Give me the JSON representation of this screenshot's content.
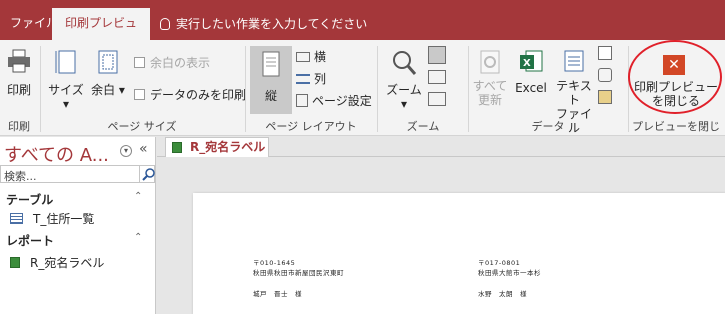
{
  "tabs": {
    "file": "ファイル",
    "print_preview": "印刷プレビュー",
    "tell_me": "実行したい作業を入力してください"
  },
  "ribbon": {
    "print": {
      "print_btn": "印刷",
      "group": "印刷"
    },
    "page_size": {
      "size": "サイズ",
      "margin": "余白",
      "show_margin": "余白の表示",
      "data_only": "データのみを印刷",
      "group": "ページ サイズ"
    },
    "page_layout": {
      "portrait": "縦",
      "landscape": "横",
      "columns": "列",
      "page_setup": "ページ設定",
      "group": "ページ レイアウト"
    },
    "zoom": {
      "zoom": "ズーム",
      "group": "ズーム"
    },
    "data": {
      "refresh_all": "すべて更新",
      "refresh_line1": "すべて",
      "refresh_line2": "更新",
      "excel": "Excel",
      "text_line1": "テキスト",
      "text_line2": "ファイル",
      "group": "データ"
    },
    "close": {
      "line1": "印刷プレビュー",
      "line2": "を閉じる",
      "group": "プレビューを閉じる"
    }
  },
  "nav": {
    "title": "すべての A...",
    "search_placeholder": "検索...",
    "sections": [
      {
        "header": "テーブル",
        "items": [
          "T_住所一覧"
        ]
      },
      {
        "header": "レポート",
        "items": [
          "R_宛名ラベル"
        ]
      }
    ]
  },
  "document": {
    "tab": "R_宛名ラベル",
    "labels": [
      {
        "zip": "〒010-1645",
        "address": "秋田県秋田市新屋団民沢東町",
        "name": "城戸　晋士　様"
      },
      {
        "zip": "〒017-0801",
        "address": "秋田県大館市一本杉",
        "name": "水野　太朗　様"
      }
    ]
  },
  "colors": {
    "accent": "#a4373a",
    "close": "#d24726",
    "highlight_ring": "#e0202a"
  }
}
